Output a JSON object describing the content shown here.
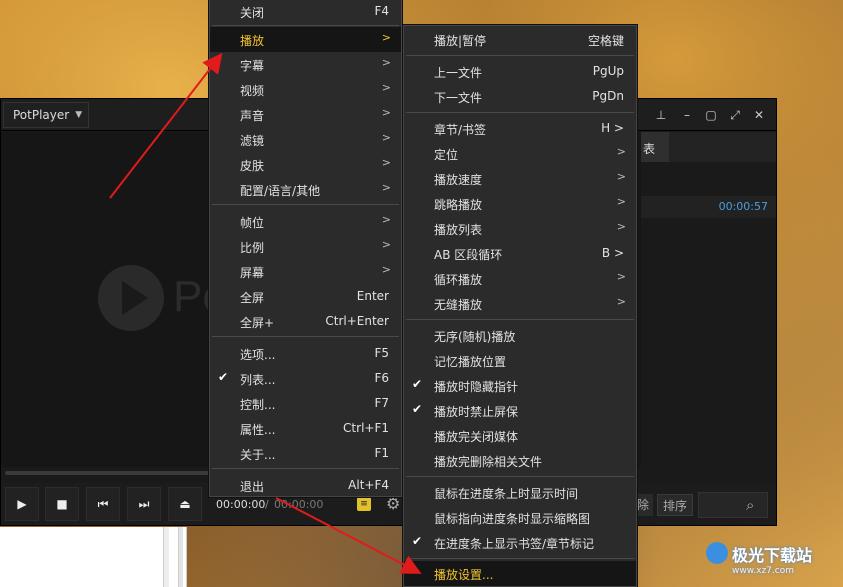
{
  "player": {
    "app_menu": "PotPlayer",
    "logo_text": "Po",
    "panel_tab": "表",
    "panel_duration": "00:00:57",
    "time_current": "00:00:00",
    "time_separator": "/",
    "time_total": "00:00:00",
    "delete_label": "除",
    "sort_label": "排序"
  },
  "menu_main": {
    "items": [
      {
        "label": "关闭",
        "key": "F4"
      },
      {
        "label": "播放",
        "arrow": ">"
      },
      {
        "label": "字幕",
        "arrow": ">"
      },
      {
        "label": "视频",
        "arrow": ">"
      },
      {
        "label": "声音",
        "arrow": ">"
      },
      {
        "label": "滤镜",
        "arrow": ">"
      },
      {
        "label": "皮肤",
        "arrow": ">"
      },
      {
        "label": "配置/语言/其他",
        "arrow": ">"
      },
      {
        "label": "帧位",
        "arrow": ">"
      },
      {
        "label": "比例",
        "arrow": ">"
      },
      {
        "label": "屏幕",
        "arrow": ">"
      },
      {
        "label": "全屏",
        "key": "Enter"
      },
      {
        "label": "全屏+",
        "key": "Ctrl+Enter"
      },
      {
        "label": "选项...",
        "key": "F5"
      },
      {
        "label": "列表...",
        "key": "F6"
      },
      {
        "label": "控制...",
        "key": "F7"
      },
      {
        "label": "属性...",
        "key": "Ctrl+F1"
      },
      {
        "label": "关于...",
        "key": "F1"
      },
      {
        "label": "退出",
        "key": "Alt+F4"
      }
    ]
  },
  "menu_play": {
    "items": [
      {
        "label": "播放|暂停",
        "key": "空格键"
      },
      {
        "label": "上一文件",
        "key": "PgUp"
      },
      {
        "label": "下一文件",
        "key": "PgDn"
      },
      {
        "label": "章节/书签",
        "key": "H >"
      },
      {
        "label": "定位",
        "arrow": ">"
      },
      {
        "label": "播放速度",
        "arrow": ">"
      },
      {
        "label": "跳略播放",
        "arrow": ">"
      },
      {
        "label": "播放列表",
        "arrow": ">"
      },
      {
        "label": "AB 区段循环",
        "key": "B >"
      },
      {
        "label": "循环播放",
        "arrow": ">"
      },
      {
        "label": "无缝播放",
        "arrow": ">"
      },
      {
        "label": "无序(随机)播放"
      },
      {
        "label": "记忆播放位置"
      },
      {
        "label": "播放时隐藏指针"
      },
      {
        "label": "播放时禁止屏保"
      },
      {
        "label": "播放完关闭媒体"
      },
      {
        "label": "播放完删除相关文件"
      },
      {
        "label": "鼠标在进度条上时显示时间"
      },
      {
        "label": "鼠标指向进度条时显示缩略图"
      },
      {
        "label": "在进度条上显示书签/章节标记"
      },
      {
        "label": "播放设置..."
      }
    ]
  },
  "watermark": {
    "text": "极光下载站",
    "url": "www.xz7.com"
  }
}
